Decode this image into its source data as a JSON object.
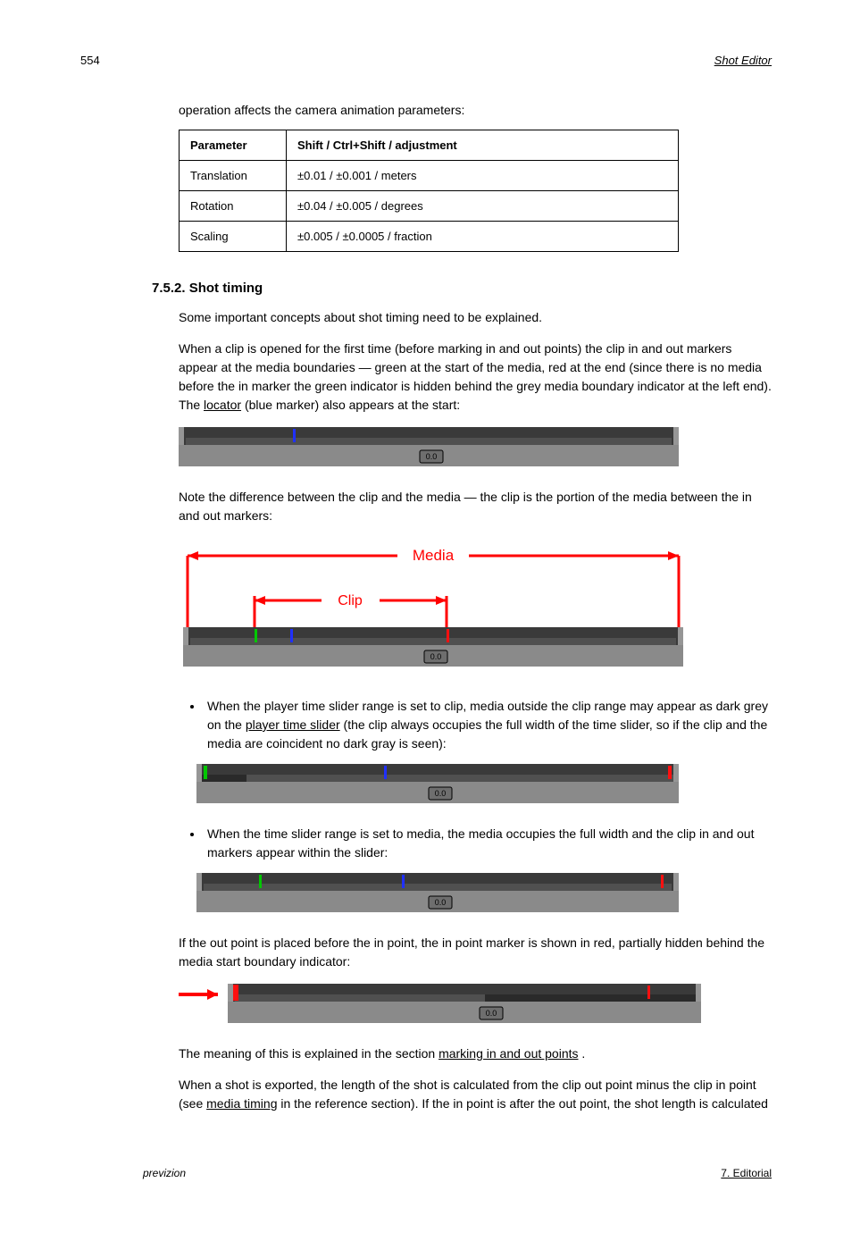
{
  "header": {
    "pageno": "554",
    "title": "Shot Editor"
  },
  "lead": "operation affects the camera animation parameters:",
  "table": {
    "h1": "Parameter",
    "h2": "Shift / Ctrl+Shift / adjustment",
    "rows": [
      [
        "Translation",
        "±0.01 / ±0.001 / meters"
      ],
      [
        "Rotation",
        "±0.04 / ±0.005 / degrees"
      ],
      [
        "Scaling",
        "±0.005 / ±0.0005 / fraction"
      ]
    ]
  },
  "h3": "7.5.2. Shot timing",
  "p1": "Some important concepts about shot timing need to be explained.",
  "p2a": "When a clip is opened for the first time (before marking in and out points) the clip in and out markers appear at the media boundaries — green at the start of the media, red at the end (since there is no media before the in marker the green indicator is hidden behind the grey media boundary indicator at the left end). The ",
  "p2link": "locator",
  "p2b": " (blue marker) also appears at the start:",
  "p3": "Note the difference between the clip and the media — the clip is the portion of the media between the in and out markers:",
  "b1a": "When the player time slider range is set to clip, media outside the clip range may appear as dark grey on the ",
  "b1link": "player time slider",
  "b1b": " (the clip always occupies the full width of the time slider, so if the clip and the media are coincident no dark gray is seen):",
  "b2": "When the time slider range is set to media, the media occupies the full width and the clip in and out markers appear within the slider:",
  "p4": "If the out point is placed before the in point, the in point marker is shown in red, partially hidden behind the media start boundary indicator:",
  "p5a": "The meaning of this is explained in the section ",
  "p5link": "marking in and out points",
  "p5b": ".",
  "p6a": "When a shot is exported, the length of the shot is calculated from the clip out point minus the clip in point (see ",
  "p6link": "media timing",
  "p6b": " in the reference section). If the in point is after the out point, the shot length is calculated",
  "labels": {
    "media": "Media",
    "clip": "Clip",
    "zero": "0.0"
  },
  "footer": {
    "product": "previzion",
    "chapter": "7. Editorial"
  }
}
